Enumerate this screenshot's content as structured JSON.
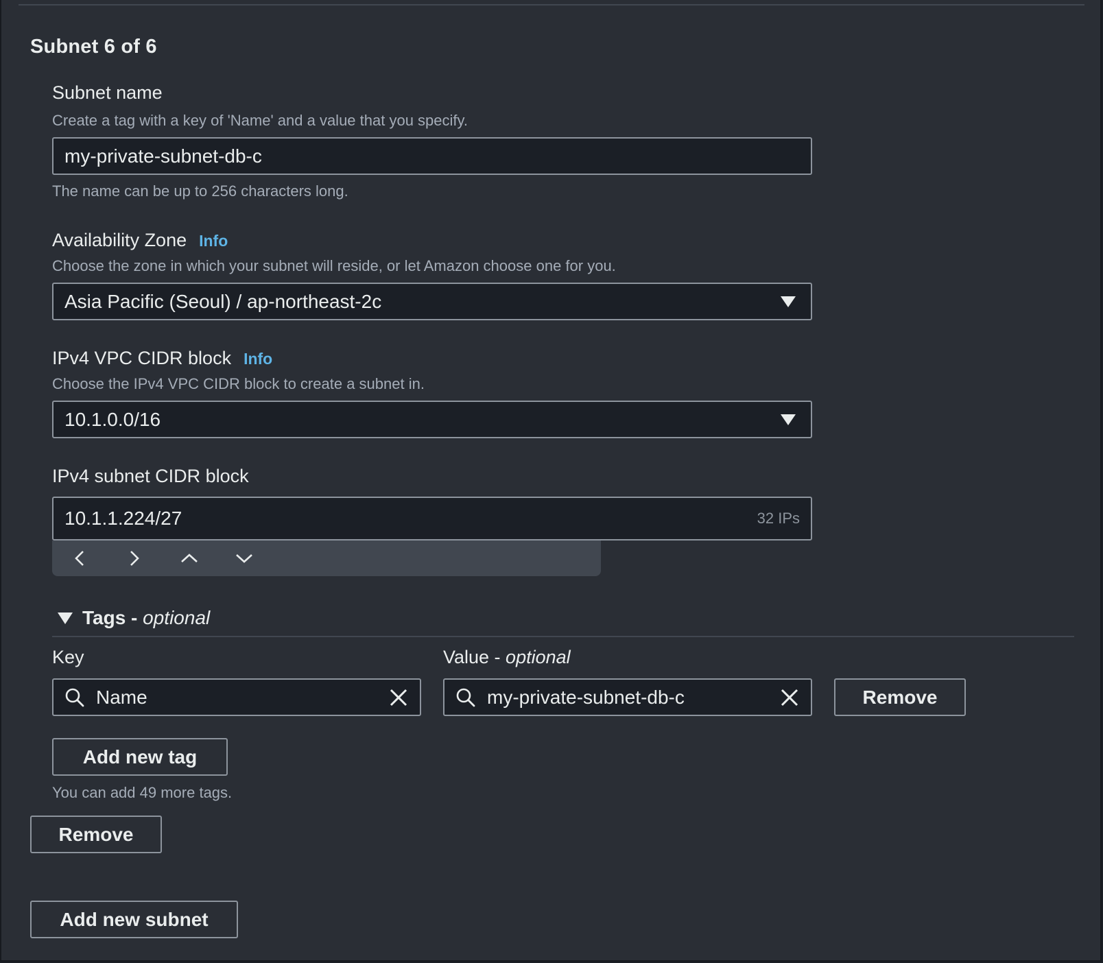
{
  "section": {
    "title": "Subnet 6 of 6"
  },
  "subnet_name": {
    "label": "Subnet name",
    "description": "Create a tag with a key of 'Name' and a value that you specify.",
    "value": "my-private-subnet-db-c",
    "constraint": "The name can be up to 256 characters long."
  },
  "availability_zone": {
    "label": "Availability Zone",
    "info": "Info",
    "description": "Choose the zone in which your subnet will reside, or let Amazon choose one for you.",
    "selected": "Asia Pacific (Seoul) / ap-northeast-2c",
    "icon": "caret-down-icon"
  },
  "vpc_cidr": {
    "label": "IPv4 VPC CIDR block",
    "info": "Info",
    "description": "Choose the IPv4 VPC CIDR block to create a subnet in.",
    "selected": "10.1.0.0/16",
    "icon": "caret-down-icon"
  },
  "subnet_cidr": {
    "label": "IPv4 subnet CIDR block",
    "value": "10.1.1.224/27",
    "ip_count": "32 IPs",
    "stepper_icons": [
      "chevron-left-icon",
      "chevron-right-icon",
      "chevron-up-icon",
      "chevron-down-icon"
    ]
  },
  "tags": {
    "title": "Tags - ",
    "title_optional": "optional",
    "key_label": "Key",
    "value_label": "Value - ",
    "value_label_optional": "optional",
    "rows": [
      {
        "key": "Name",
        "value": "my-private-subnet-db-c",
        "remove_label": "Remove"
      }
    ],
    "add_label": "Add new tag",
    "limit_text": "You can add 49 more tags."
  },
  "remove_subnet_label": "Remove",
  "add_subnet_label": "Add new subnet",
  "colors": {
    "background": "#2a2e35",
    "input_background": "#1b1f26",
    "border": "#8d949d",
    "link": "#5eb4e6",
    "secondary_text": "#a5adb8"
  }
}
